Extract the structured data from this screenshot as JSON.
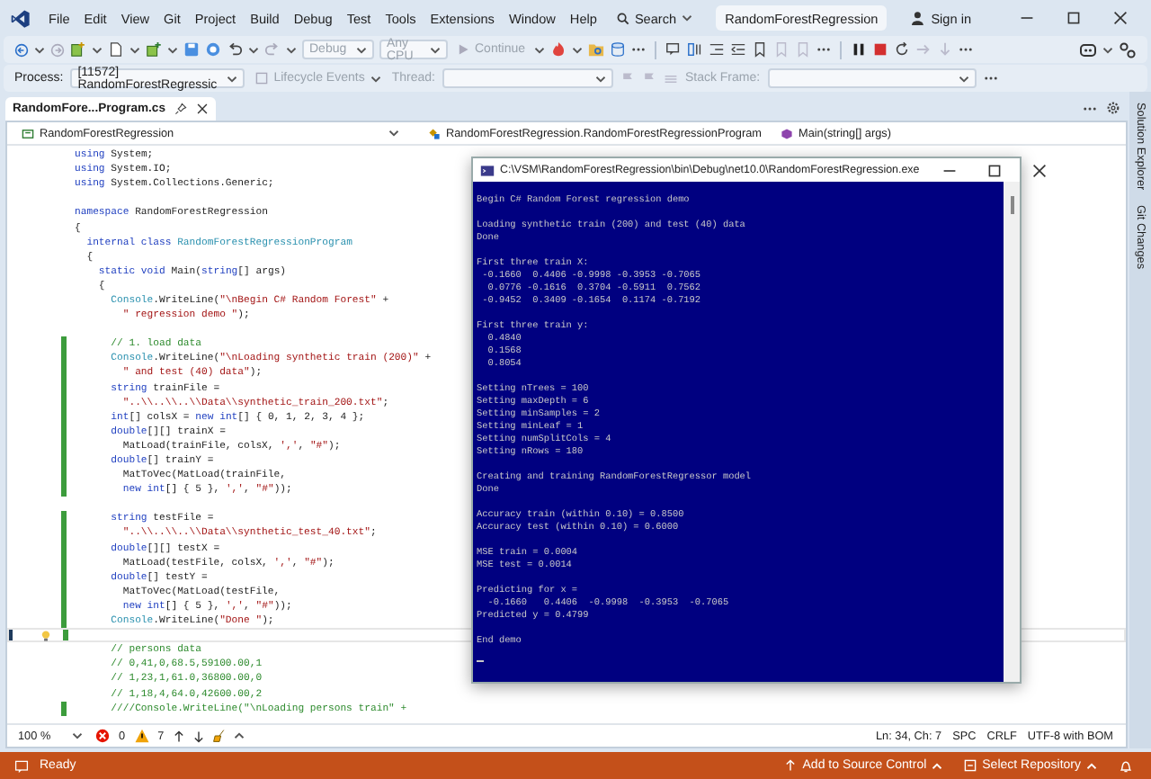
{
  "menu": [
    "File",
    "Edit",
    "View",
    "Git",
    "Project",
    "Build",
    "Debug",
    "Test",
    "Tools",
    "Extensions",
    "Window",
    "Help"
  ],
  "search": "Search",
  "solution_title": "RandomForestRegression",
  "account": "Sign in",
  "toolbar": {
    "configuration": {
      "text": "Debug",
      "disabled": true
    },
    "platform": {
      "text": "Any CPU",
      "disabled": true
    },
    "continue": {
      "text": "Continue",
      "disabled": true
    }
  },
  "debug_bar": {
    "process_label": "Process:",
    "process": "[11572] RandomForestRegressic",
    "lifecycle": {
      "text": "Lifecycle Events",
      "disabled": true
    },
    "thread_label": "Thread:",
    "stack_label": "Stack Frame:"
  },
  "tabs": [
    {
      "title": "RandomFore...Program.cs",
      "selected": true
    }
  ],
  "navigation": [
    "RandomForestRegression",
    "RandomForestRegression.RandomForestRegressionProgram",
    "Main(string[] args)"
  ],
  "code": [
    {
      "changed": false,
      "current": false,
      "tokens": [
        {
          "kind": "k",
          "text": "using"
        },
        {
          "kind": "p",
          "text": " System;"
        }
      ]
    },
    {
      "changed": false,
      "current": false,
      "tokens": [
        {
          "kind": "k",
          "text": "using"
        },
        {
          "kind": "p",
          "text": " System.IO;"
        }
      ]
    },
    {
      "changed": false,
      "current": false,
      "tokens": [
        {
          "kind": "k",
          "text": "using"
        },
        {
          "kind": "p",
          "text": " System.Collections.Generic;"
        }
      ]
    },
    {
      "changed": false,
      "current": false
    },
    {
      "changed": false,
      "current": false,
      "tokens": [
        {
          "kind": "k",
          "text": "namespace"
        },
        {
          "kind": "p",
          "text": " RandomForestRegression"
        }
      ]
    },
    {
      "changed": false,
      "current": false,
      "tokens": [
        {
          "kind": "p",
          "text": "{"
        }
      ]
    },
    {
      "changed": false,
      "current": false,
      "tokens": [
        {
          "kind": "k",
          "text": "  internal class "
        },
        {
          "kind": "t",
          "text": "RandomForestRegressionProgram"
        }
      ]
    },
    {
      "changed": false,
      "current": false,
      "tokens": [
        {
          "kind": "p",
          "text": "  {"
        }
      ]
    },
    {
      "changed": false,
      "current": false,
      "tokens": [
        {
          "kind": "k",
          "text": "    static void"
        },
        {
          "kind": "p",
          "text": " Main("
        },
        {
          "kind": "k",
          "text": "string"
        },
        {
          "kind": "p",
          "text": "[] args)"
        }
      ]
    },
    {
      "changed": false,
      "current": false,
      "tokens": [
        {
          "kind": "p",
          "text": "    {"
        }
      ]
    },
    {
      "changed": false,
      "current": false,
      "tokens": [
        {
          "kind": "t",
          "text": "      Console"
        },
        {
          "kind": "p",
          "text": ".WriteLine("
        },
        {
          "kind": "s",
          "text": "\"\\nBegin C# Random Forest\""
        },
        {
          "kind": "p",
          "text": " +"
        }
      ]
    },
    {
      "changed": false,
      "current": false,
      "tokens": [
        {
          "kind": "s",
          "text": "        \" regression demo \""
        },
        {
          "kind": "p",
          "text": ");"
        }
      ]
    },
    {
      "changed": false,
      "current": false
    },
    {
      "changed": true,
      "current": false,
      "tokens": [
        {
          "kind": "c",
          "text": "      // 1. load data"
        }
      ]
    },
    {
      "changed": true,
      "current": false,
      "tokens": [
        {
          "kind": "t",
          "text": "      Console"
        },
        {
          "kind": "p",
          "text": ".WriteLine("
        },
        {
          "kind": "s",
          "text": "\"\\nLoading synthetic train (200)\""
        },
        {
          "kind": "p",
          "text": " +"
        }
      ]
    },
    {
      "changed": true,
      "current": false,
      "tokens": [
        {
          "kind": "s",
          "text": "        \" and test (40) data\""
        },
        {
          "kind": "p",
          "text": ");"
        }
      ]
    },
    {
      "changed": true,
      "current": false,
      "tokens": [
        {
          "kind": "k",
          "text": "      string"
        },
        {
          "kind": "p",
          "text": " trainFile ="
        }
      ]
    },
    {
      "changed": true,
      "current": false,
      "tokens": [
        {
          "kind": "s",
          "text": "        \"..\\\\..\\\\..\\\\Data\\\\synthetic_train_200.txt\""
        },
        {
          "kind": "p",
          "text": ";"
        }
      ]
    },
    {
      "changed": true,
      "current": false,
      "tokens": [
        {
          "kind": "k",
          "text": "      int"
        },
        {
          "kind": "p",
          "text": "[] colsX = "
        },
        {
          "kind": "k",
          "text": "new int"
        },
        {
          "kind": "p",
          "text": "[] { 0, 1, 2, 3, 4 };"
        }
      ]
    },
    {
      "changed": true,
      "current": false,
      "tokens": [
        {
          "kind": "k",
          "text": "      double"
        },
        {
          "kind": "p",
          "text": "[][] trainX ="
        }
      ]
    },
    {
      "changed": true,
      "current": false,
      "tokens": [
        {
          "kind": "p",
          "text": "        MatLoad(trainFile, colsX, "
        },
        {
          "kind": "s",
          "text": "','"
        },
        {
          "kind": "p",
          "text": ", "
        },
        {
          "kind": "s",
          "text": "\"#\""
        },
        {
          "kind": "p",
          "text": ");"
        }
      ]
    },
    {
      "changed": true,
      "current": false,
      "tokens": [
        {
          "kind": "k",
          "text": "      double"
        },
        {
          "kind": "p",
          "text": "[] trainY ="
        }
      ]
    },
    {
      "changed": true,
      "current": false,
      "tokens": [
        {
          "kind": "p",
          "text": "        MatToVec(MatLoad(trainFile,"
        }
      ]
    },
    {
      "changed": true,
      "current": false,
      "tokens": [
        {
          "kind": "k",
          "text": "        new int"
        },
        {
          "kind": "p",
          "text": "[] { 5 }, "
        },
        {
          "kind": "s",
          "text": "','"
        },
        {
          "kind": "p",
          "text": ", "
        },
        {
          "kind": "s",
          "text": "\"#\""
        },
        {
          "kind": "p",
          "text": "));"
        }
      ]
    },
    {
      "changed": false,
      "current": false
    },
    {
      "changed": true,
      "current": false,
      "tokens": [
        {
          "kind": "k",
          "text": "      string"
        },
        {
          "kind": "p",
          "text": " testFile ="
        }
      ]
    },
    {
      "changed": true,
      "current": false,
      "tokens": [
        {
          "kind": "s",
          "text": "        \"..\\\\..\\\\..\\\\Data\\\\synthetic_test_40.txt\""
        },
        {
          "kind": "p",
          "text": ";"
        }
      ]
    },
    {
      "changed": true,
      "current": false,
      "tokens": [
        {
          "kind": "k",
          "text": "      double"
        },
        {
          "kind": "p",
          "text": "[][] testX ="
        }
      ]
    },
    {
      "changed": true,
      "current": false,
      "tokens": [
        {
          "kind": "p",
          "text": "        MatLoad(testFile, colsX, "
        },
        {
          "kind": "s",
          "text": "','"
        },
        {
          "kind": "p",
          "text": ", "
        },
        {
          "kind": "s",
          "text": "\"#\""
        },
        {
          "kind": "p",
          "text": ");"
        }
      ]
    },
    {
      "changed": true,
      "current": false,
      "tokens": [
        {
          "kind": "k",
          "text": "      double"
        },
        {
          "kind": "p",
          "text": "[] testY ="
        }
      ]
    },
    {
      "changed": true,
      "current": false,
      "tokens": [
        {
          "kind": "p",
          "text": "        MatToVec(MatLoad(testFile,"
        }
      ]
    },
    {
      "changed": true,
      "current": false,
      "tokens": [
        {
          "kind": "k",
          "text": "        new int"
        },
        {
          "kind": "p",
          "text": "[] { 5 }, "
        },
        {
          "kind": "s",
          "text": "','"
        },
        {
          "kind": "p",
          "text": ", "
        },
        {
          "kind": "s",
          "text": "\"#\""
        },
        {
          "kind": "p",
          "text": "));"
        }
      ]
    },
    {
      "changed": true,
      "current": false,
      "tokens": [
        {
          "kind": "t",
          "text": "      Console"
        },
        {
          "kind": "p",
          "text": ".WriteLine("
        },
        {
          "kind": "s",
          "text": "\"Done \""
        },
        {
          "kind": "p",
          "text": ");"
        }
      ]
    },
    {
      "changed": true,
      "current": true
    },
    {
      "changed": false,
      "current": false,
      "tokens": [
        {
          "kind": "c",
          "text": "      // persons data"
        }
      ]
    },
    {
      "changed": false,
      "current": false,
      "tokens": [
        {
          "kind": "c",
          "text": "      // 0,41,0,68.5,59100.00,1"
        }
      ]
    },
    {
      "changed": false,
      "current": false,
      "tokens": [
        {
          "kind": "c",
          "text": "      // 1,23,1,61.0,36800.00,0"
        }
      ]
    },
    {
      "changed": false,
      "current": false,
      "tokens": [
        {
          "kind": "c",
          "text": "      // 1,18,4,64.0,42600.00,2"
        }
      ]
    },
    {
      "changed": true,
      "current": false,
      "tokens": [
        {
          "kind": "c",
          "text": "      ////Console.WriteLine(\"\\nLoading persons train\" +"
        }
      ]
    }
  ],
  "editor_status": {
    "zoom": "100 %",
    "errors": "0",
    "warnings": "7",
    "position": "Ln: 34, Ch: 7",
    "indent": "SPC",
    "line_endings": "CRLF",
    "encoding": "UTF-8 with BOM"
  },
  "side_tabs": [
    "Solution Explorer",
    "Git Changes"
  ],
  "console": {
    "title": "C:\\VSM\\RandomForestRegression\\bin\\Debug\\net10.0\\RandomForestRegression.exe",
    "blocks": [
      [
        "Begin C# Random Forest regression demo"
      ],
      [
        "Loading synthetic train (200) and test (40) data",
        "Done"
      ],
      [
        "First three train X:",
        " -0.1660  0.4406 -0.9998 -0.3953 -0.7065",
        "  0.0776 -0.1616  0.3704 -0.5911  0.7562",
        " -0.9452  0.3409 -0.1654  0.1174 -0.7192"
      ],
      [
        "First three train y:",
        "  0.4840",
        "  0.1568",
        "  0.8054"
      ],
      [
        "Setting nTrees = 100",
        "Setting maxDepth = 6",
        "Setting minSamples = 2",
        "Setting minLeaf = 1",
        "Setting numSplitCols = 4",
        "Setting nRows = 180"
      ],
      [
        "Creating and training RandomForestRegressor model",
        "Done"
      ],
      [
        "Accuracy train (within 0.10) = 0.8500",
        "Accuracy test (within 0.10) = 0.6000"
      ],
      [
        "MSE train = 0.0004",
        "MSE test = 0.0014"
      ],
      [
        "Predicting for x =",
        "  -0.1660   0.4406  -0.9998  -0.3953  -0.7065",
        "Predicted y = 0.4799"
      ],
      [
        "End demo"
      ]
    ]
  },
  "status_bar": {
    "state": "Ready",
    "source_control": "Add to Source Control",
    "repository": "Select Repository"
  }
}
